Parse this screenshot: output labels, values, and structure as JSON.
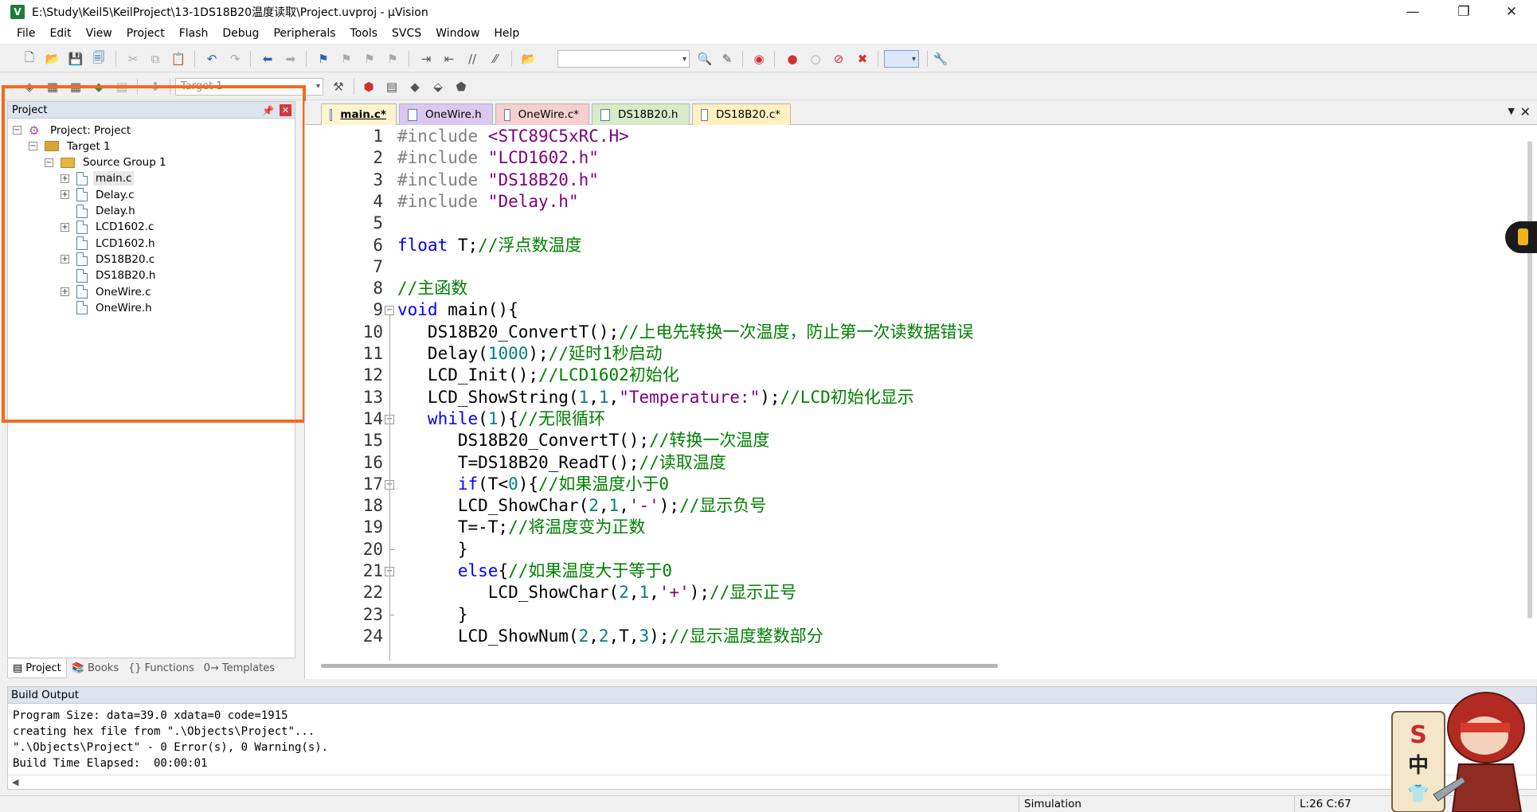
{
  "window": {
    "title": "E:\\Study\\Keil5\\KeilProject\\13-1DS18B20温度读取\\Project.uvproj - µVision",
    "controls": [
      "minimize-icon",
      "restore-icon",
      "close-icon"
    ]
  },
  "menu": [
    "File",
    "Edit",
    "View",
    "Project",
    "Flash",
    "Debug",
    "Peripherals",
    "Tools",
    "SVCS",
    "Window",
    "Help"
  ],
  "toolbar2": {
    "target": "Target 1"
  },
  "project_panel": {
    "title": "Project",
    "tree": [
      {
        "label": "Project: Project",
        "type": "project",
        "expander": "⊟"
      },
      {
        "label": "Target 1",
        "type": "target",
        "expander": "⊟"
      },
      {
        "label": "Source Group 1",
        "type": "folder",
        "expander": "⊟"
      },
      {
        "label": "main.c",
        "type": "file",
        "expander": "⊞",
        "selected": true
      },
      {
        "label": "Delay.c",
        "type": "file",
        "expander": "⊞"
      },
      {
        "label": "Delay.h",
        "type": "file",
        "expander": ""
      },
      {
        "label": "LCD1602.c",
        "type": "file",
        "expander": "⊞"
      },
      {
        "label": "LCD1602.h",
        "type": "file",
        "expander": ""
      },
      {
        "label": "DS18B20.c",
        "type": "file",
        "expander": "⊞"
      },
      {
        "label": "DS18B20.h",
        "type": "file",
        "expander": ""
      },
      {
        "label": "OneWire.c",
        "type": "file",
        "expander": "⊞"
      },
      {
        "label": "OneWire.h",
        "type": "file",
        "expander": ""
      }
    ],
    "bottom_tabs": [
      {
        "label": "Project",
        "icon": "project-tab-icon",
        "active": true
      },
      {
        "label": "Books",
        "icon": "books-tab-icon",
        "active": false
      },
      {
        "label": "Functions",
        "icon": "functions-tab-icon",
        "active": false
      },
      {
        "label": "Templates",
        "icon": "templates-tab-icon",
        "active": false
      }
    ],
    "highlight_color": "#f26a21"
  },
  "editor": {
    "tabs": [
      {
        "label": "main.c*",
        "color": "#fff4cf",
        "active": true
      },
      {
        "label": "OneWire.h",
        "color": "#d9c9ef",
        "active": false
      },
      {
        "label": "OneWire.c*",
        "color": "#f6cfcf",
        "active": false
      },
      {
        "label": "DS18B20.h",
        "color": "#d7ebc9",
        "active": false
      },
      {
        "label": "DS18B20.c*",
        "color": "#fff0c0",
        "active": false
      }
    ],
    "lines": [
      {
        "n": "1",
        "fold": "",
        "tokens": [
          [
            "pp",
            "#include "
          ],
          [
            "s",
            "<STC89C5xRC.H>"
          ]
        ]
      },
      {
        "n": "2",
        "fold": "",
        "tokens": [
          [
            "pp",
            "#include "
          ],
          [
            "s",
            "\"LCD1602.h\""
          ]
        ]
      },
      {
        "n": "3",
        "fold": "",
        "tokens": [
          [
            "pp",
            "#include "
          ],
          [
            "s",
            "\"DS18B20.h\""
          ]
        ]
      },
      {
        "n": "4",
        "fold": "",
        "tokens": [
          [
            "pp",
            "#include "
          ],
          [
            "s",
            "\"Delay.h\""
          ]
        ]
      },
      {
        "n": "5",
        "fold": "",
        "tokens": []
      },
      {
        "n": "6",
        "fold": "",
        "tokens": [
          [
            "k",
            "float"
          ],
          [
            "t",
            " T;"
          ],
          [
            "c",
            "//浮点数温度"
          ]
        ]
      },
      {
        "n": "7",
        "fold": "",
        "tokens": []
      },
      {
        "n": "8",
        "fold": "",
        "tokens": [
          [
            "c",
            "//主函数"
          ]
        ]
      },
      {
        "n": "9",
        "fold": "⊟",
        "tokens": [
          [
            "k",
            "void"
          ],
          [
            "t",
            " main(){"
          ]
        ]
      },
      {
        "n": "10",
        "fold": "",
        "tokens": [
          [
            "t",
            "   DS18B20_ConvertT();"
          ],
          [
            "c",
            "//上电先转换一次温度，防止第一次读数据错误"
          ]
        ]
      },
      {
        "n": "11",
        "fold": "",
        "tokens": [
          [
            "t",
            "   Delay("
          ],
          [
            "n",
            "1000"
          ],
          [
            "t",
            ");"
          ],
          [
            "c",
            "//延时1秒启动"
          ]
        ]
      },
      {
        "n": "12",
        "fold": "",
        "tokens": [
          [
            "t",
            "   LCD_Init();"
          ],
          [
            "c",
            "//LCD1602初始化"
          ]
        ]
      },
      {
        "n": "13",
        "fold": "",
        "tokens": [
          [
            "t",
            "   LCD_ShowString("
          ],
          [
            "n",
            "1"
          ],
          [
            "t",
            ","
          ],
          [
            "n",
            "1"
          ],
          [
            "t",
            ","
          ],
          [
            "s",
            "\"Temperature:\""
          ],
          [
            "t",
            ");"
          ],
          [
            "c",
            "//LCD初始化显示"
          ]
        ]
      },
      {
        "n": "14",
        "fold": "⊟",
        "tokens": [
          [
            "k",
            "   while"
          ],
          [
            "t",
            "("
          ],
          [
            "n",
            "1"
          ],
          [
            "t",
            "){"
          ],
          [
            "c",
            "//无限循环"
          ]
        ]
      },
      {
        "n": "15",
        "fold": "",
        "tokens": [
          [
            "t",
            "      DS18B20_ConvertT();"
          ],
          [
            "c",
            "//转换一次温度"
          ]
        ]
      },
      {
        "n": "16",
        "fold": "",
        "tokens": [
          [
            "t",
            "      T=DS18B20_ReadT();"
          ],
          [
            "c",
            "//读取温度"
          ]
        ]
      },
      {
        "n": "17",
        "fold": "⊟",
        "tokens": [
          [
            "k",
            "      if"
          ],
          [
            "t",
            "(T<"
          ],
          [
            "n",
            "0"
          ],
          [
            "t",
            "){"
          ],
          [
            "c",
            "//如果温度小于0"
          ]
        ]
      },
      {
        "n": "18",
        "fold": "",
        "tokens": [
          [
            "t",
            "      LCD_ShowChar("
          ],
          [
            "n",
            "2"
          ],
          [
            "t",
            ","
          ],
          [
            "n",
            "1"
          ],
          [
            "t",
            ","
          ],
          [
            "s",
            "'-'"
          ],
          [
            "t",
            ");"
          ],
          [
            "c",
            "//显示负号"
          ]
        ]
      },
      {
        "n": "19",
        "fold": "",
        "tokens": [
          [
            "t",
            "      T=-T;"
          ],
          [
            "c",
            "//将温度变为正数"
          ]
        ]
      },
      {
        "n": "20",
        "fold": "end",
        "tokens": [
          [
            "t",
            "      }"
          ]
        ]
      },
      {
        "n": "21",
        "fold": "⊟",
        "tokens": [
          [
            "k",
            "      else"
          ],
          [
            "t",
            "{"
          ],
          [
            "c",
            "//如果温度大于等于0"
          ]
        ]
      },
      {
        "n": "22",
        "fold": "",
        "tokens": [
          [
            "t",
            "         LCD_ShowChar("
          ],
          [
            "n",
            "2"
          ],
          [
            "t",
            ","
          ],
          [
            "n",
            "1"
          ],
          [
            "t",
            ","
          ],
          [
            "s",
            "'+'"
          ],
          [
            "t",
            ");"
          ],
          [
            "c",
            "//显示正号"
          ]
        ]
      },
      {
        "n": "23",
        "fold": "end",
        "tokens": [
          [
            "t",
            "      }"
          ]
        ]
      },
      {
        "n": "24",
        "fold": "",
        "tokens": [
          [
            "t",
            "      LCD_ShowNum("
          ],
          [
            "n",
            "2"
          ],
          [
            "t",
            ","
          ],
          [
            "n",
            "2"
          ],
          [
            "t",
            ",T,"
          ],
          [
            "n",
            "3"
          ],
          [
            "t",
            ");"
          ],
          [
            "c",
            "//显示温度整数部分"
          ]
        ]
      }
    ]
  },
  "build_output": {
    "title": "Build Output",
    "lines": [
      "Program Size: data=39.0 xdata=0 code=1915",
      "creating hex file from \".\\Objects\\Project\"...",
      "\".\\Objects\\Project\" - 0 Error(s), 0 Warning(s).",
      "Build Time Elapsed:  00:00:01"
    ]
  },
  "status": {
    "mode": "Simulation",
    "position": "L:26 C:67"
  }
}
